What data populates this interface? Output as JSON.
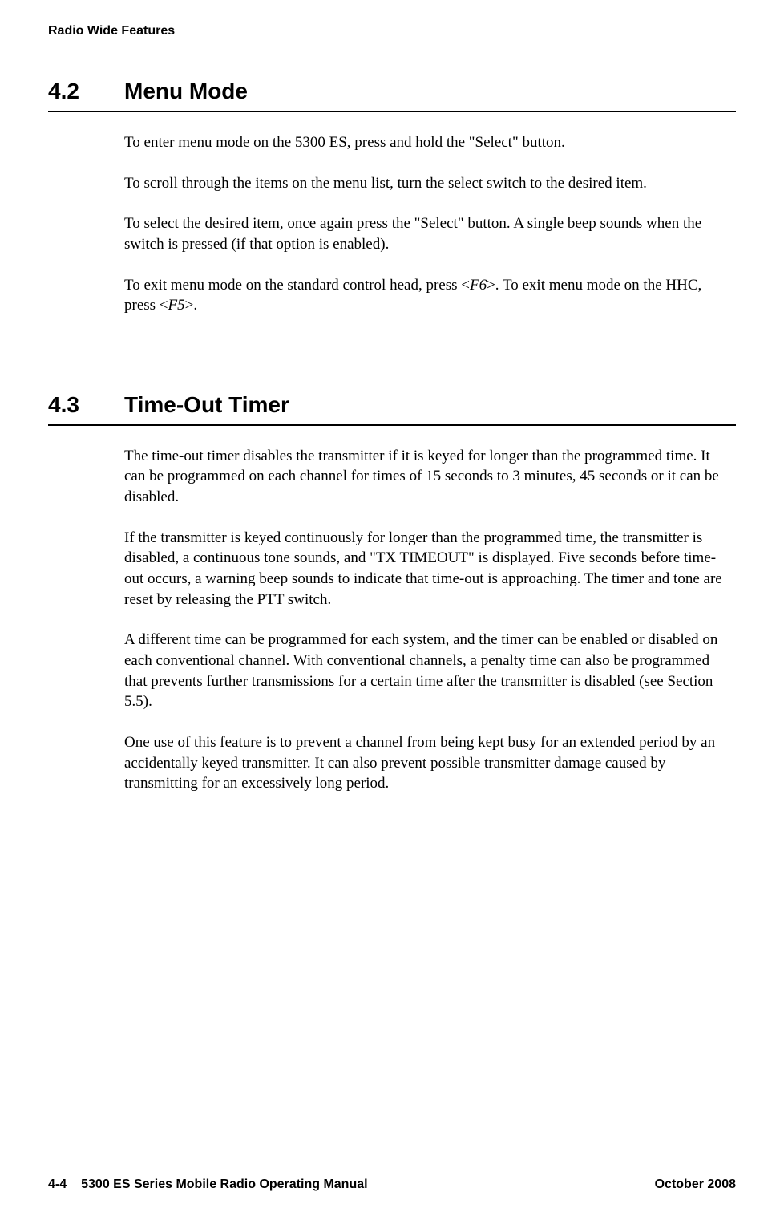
{
  "header": {
    "title": "Radio Wide Features"
  },
  "sections": [
    {
      "number": "4.2",
      "title": "Menu Mode",
      "paragraphs": [
        "To enter menu mode on the 5300 ES, press and hold the \"Select\" button.",
        "To scroll through the items on the menu list, turn the select switch to the desired item.",
        "To select the desired item, once again press the \"Select\" button. A single beep sounds when the switch is pressed (if that option is enabled).",
        "To exit menu mode on the standard control head, press <F6>. To exit menu mode on the HHC, press <F5>."
      ]
    },
    {
      "number": "4.3",
      "title": "Time-Out Timer",
      "paragraphs": [
        "The time-out timer disables the transmitter if it is keyed for longer than the programmed time. It can be programmed on each channel for times of 15 seconds to 3 minutes, 45 seconds or it can be disabled.",
        "If the transmitter is keyed continuously for longer than the programmed time, the transmitter is disabled, a continuous tone sounds, and \"TX TIMEOUT\" is displayed. Five seconds before time-out occurs, a warning beep sounds to indicate that time-out is approaching. The timer and tone are reset by releasing the PTT switch.",
        "A different time can be programmed for each system, and the timer can be enabled or disabled on each conventional channel. With conventional channels, a penalty time can also be programmed that prevents further transmissions for a certain time after the transmitter is disabled (see Section 5.5).",
        "One use of this feature is to prevent a channel from being kept busy for an extended period by an accidentally keyed transmitter. It can also prevent possible transmitter damage caused by transmitting for an excessively long period."
      ]
    }
  ],
  "special": {
    "s0p3_pre": "To exit menu mode on the standard control head, press <",
    "s0p3_f6": "F6",
    "s0p3_mid": ">. To exit menu mode on the HHC, press <",
    "s0p3_f5": "F5",
    "s0p3_post": ">."
  },
  "footer": {
    "page": "4-4",
    "manual": "5300 ES Series Mobile Radio Operating Manual",
    "date": "October 2008"
  }
}
